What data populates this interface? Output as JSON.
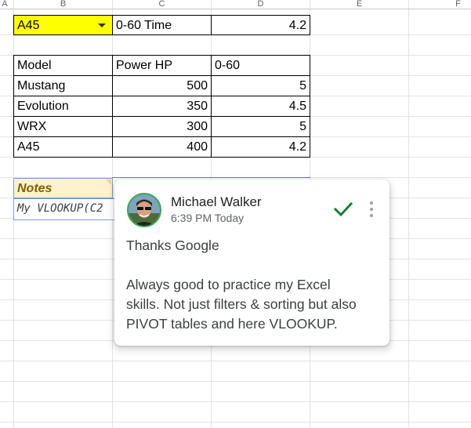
{
  "column_headers": [
    "A",
    "B",
    "C",
    "D",
    "E",
    "F"
  ],
  "lookup_row": {
    "selector_value": "A45",
    "label": "0-60 Time",
    "result": "4.2"
  },
  "table": {
    "headers": [
      "Model",
      "Power HP",
      "0-60"
    ],
    "rows": [
      [
        "Mustang",
        "500",
        "5"
      ],
      [
        "Evolution",
        "350",
        "4.5"
      ],
      [
        "WRX",
        "300",
        "5"
      ],
      [
        "A45",
        "400",
        "4.2"
      ]
    ]
  },
  "notes": {
    "label": "Notes",
    "formula_preview": "My VLOOKUP(C2"
  },
  "comment": {
    "author": "Michael Walker",
    "timestamp": "6:39 PM Today",
    "lines": [
      "Thanks Google",
      "",
      "Always good to practice my Excel",
      "skills.  Not just filters & sorting but also",
      "PIVOT tables and here VLOOKUP."
    ]
  },
  "colors": {
    "dropdown_fill": "#ffff00",
    "notes_fill": "#fff2cc",
    "notes_text": "#7f6000",
    "resolve_check": "#188038",
    "avatar_ring": "#34a853",
    "selection_blue": "#4f7fd8"
  },
  "icons": [
    "dropdown-arrow-icon",
    "resolve-check-icon",
    "more-options-icon",
    "avatar-photo"
  ]
}
